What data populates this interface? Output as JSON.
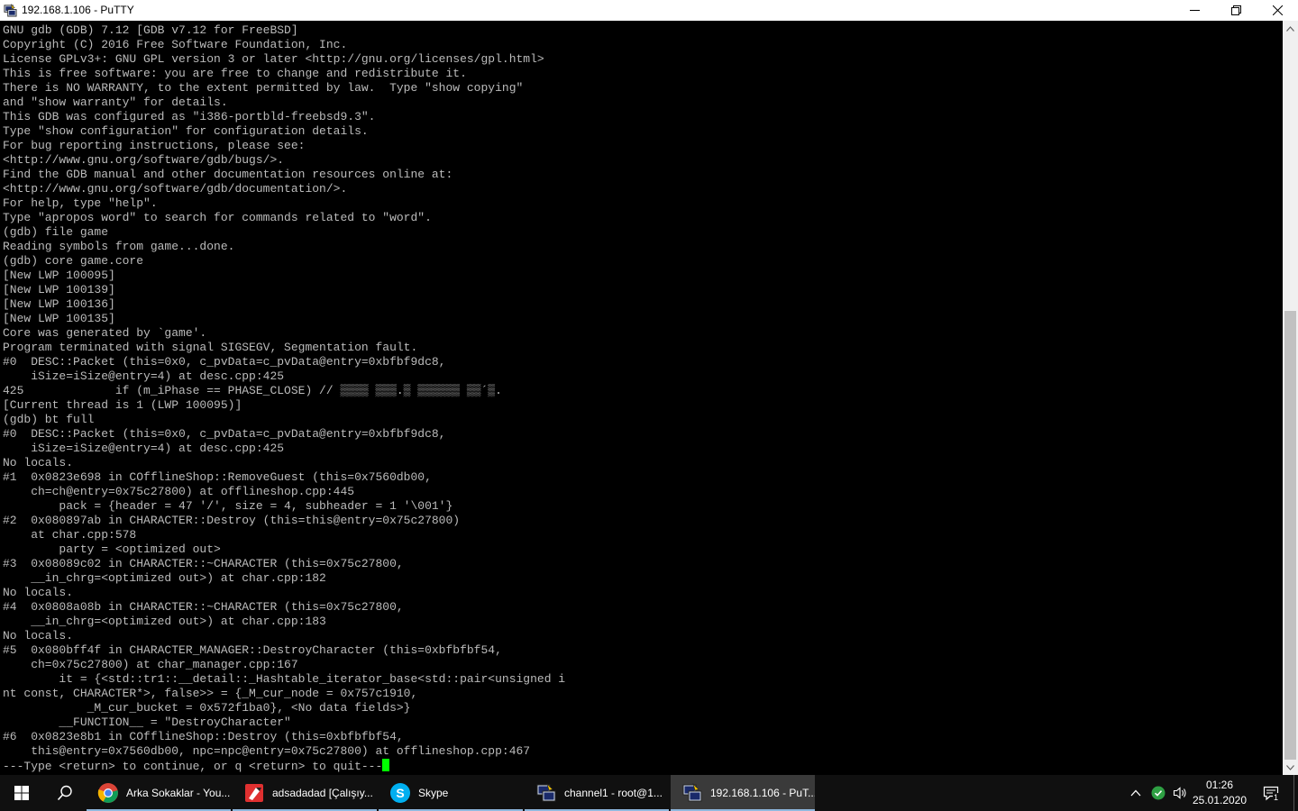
{
  "window": {
    "title": "192.168.1.106 - PuTTY",
    "icon": "putty-icon"
  },
  "terminal": {
    "fg_color": "#bbbbbb",
    "bg_color": "#000000",
    "cursor_color": "#00ff00",
    "lines": [
      "GNU gdb (GDB) 7.12 [GDB v7.12 for FreeBSD]",
      "Copyright (C) 2016 Free Software Foundation, Inc.",
      "License GPLv3+: GNU GPL version 3 or later <http://gnu.org/licenses/gpl.html>",
      "This is free software: you are free to change and redistribute it.",
      "There is NO WARRANTY, to the extent permitted by law.  Type \"show copying\"",
      "and \"show warranty\" for details.",
      "This GDB was configured as \"i386-portbld-freebsd9.3\".",
      "Type \"show configuration\" for configuration details.",
      "For bug reporting instructions, please see:",
      "<http://www.gnu.org/software/gdb/bugs/>.",
      "Find the GDB manual and other documentation resources online at:",
      "<http://www.gnu.org/software/gdb/documentation/>.",
      "For help, type \"help\".",
      "Type \"apropos word\" to search for commands related to \"word\".",
      "(gdb) file game",
      "Reading symbols from game...done.",
      "(gdb) core game.core",
      "[New LWP 100095]",
      "[New LWP 100139]",
      "[New LWP 100136]",
      "[New LWP 100135]",
      "Core was generated by `game'.",
      "Program terminated with signal SIGSEGV, Segmentation fault.",
      "#0  DESC::Packet (this=0x0, c_pvData=c_pvData@entry=0xbfbf9dc8,",
      "    iSize=iSize@entry=4) at desc.cpp:425",
      "425             if (m_iPhase == PHASE_CLOSE) // ▒▒▒▒ ▒▒▒.▒ ▒▒▒▒▒▒ ▒▒´▒.",
      "[Current thread is 1 (LWP 100095)]",
      "(gdb) bt full",
      "#0  DESC::Packet (this=0x0, c_pvData=c_pvData@entry=0xbfbf9dc8,",
      "    iSize=iSize@entry=4) at desc.cpp:425",
      "No locals.",
      "#1  0x0823e698 in COfflineShop::RemoveGuest (this=0x7560db00,",
      "    ch=ch@entry=0x75c27800) at offlineshop.cpp:445",
      "        pack = {header = 47 '/', size = 4, subheader = 1 '\\001'}",
      "#2  0x080897ab in CHARACTER::Destroy (this=this@entry=0x75c27800)",
      "    at char.cpp:578",
      "        party = <optimized out>",
      "#3  0x08089c02 in CHARACTER::~CHARACTER (this=0x75c27800,",
      "    __in_chrg=<optimized out>) at char.cpp:182",
      "No locals.",
      "#4  0x0808a08b in CHARACTER::~CHARACTER (this=0x75c27800,",
      "    __in_chrg=<optimized out>) at char.cpp:183",
      "No locals.",
      "#5  0x080bff4f in CHARACTER_MANAGER::DestroyCharacter (this=0xbfbfbf54,",
      "    ch=0x75c27800) at char_manager.cpp:167",
      "        it = {<std::tr1::__detail::_Hashtable_iterator_base<std::pair<unsigned i",
      "nt const, CHARACTER*>, false>> = {_M_cur_node = 0x757c1910,",
      "            _M_cur_bucket = 0x572f1ba0}, <No data fields>}",
      "        __FUNCTION__ = \"DestroyCharacter\"",
      "#6  0x0823e8b1 in COfflineShop::Destroy (this=0xbfbfbf54,",
      "    this@entry=0x7560db00, npc=npc@entry=0x75c27800) at offlineshop.cpp:467",
      "---Type <return> to continue, or q <return> to quit---"
    ]
  },
  "taskbar": {
    "items": [
      {
        "label": "Arka Sokaklar - You...",
        "icon": "chrome-icon"
      },
      {
        "label": "adsadadad [Çalışıy...",
        "icon": "app-red-icon"
      },
      {
        "label": "Skype",
        "icon": "skype-icon"
      },
      {
        "label": "channel1 - root@1...",
        "icon": "putty-icon"
      },
      {
        "label": "192.168.1.106 - PuT...",
        "icon": "putty-icon"
      }
    ],
    "time": "01:26",
    "date": "25.01.2020",
    "notification_count": "1"
  }
}
